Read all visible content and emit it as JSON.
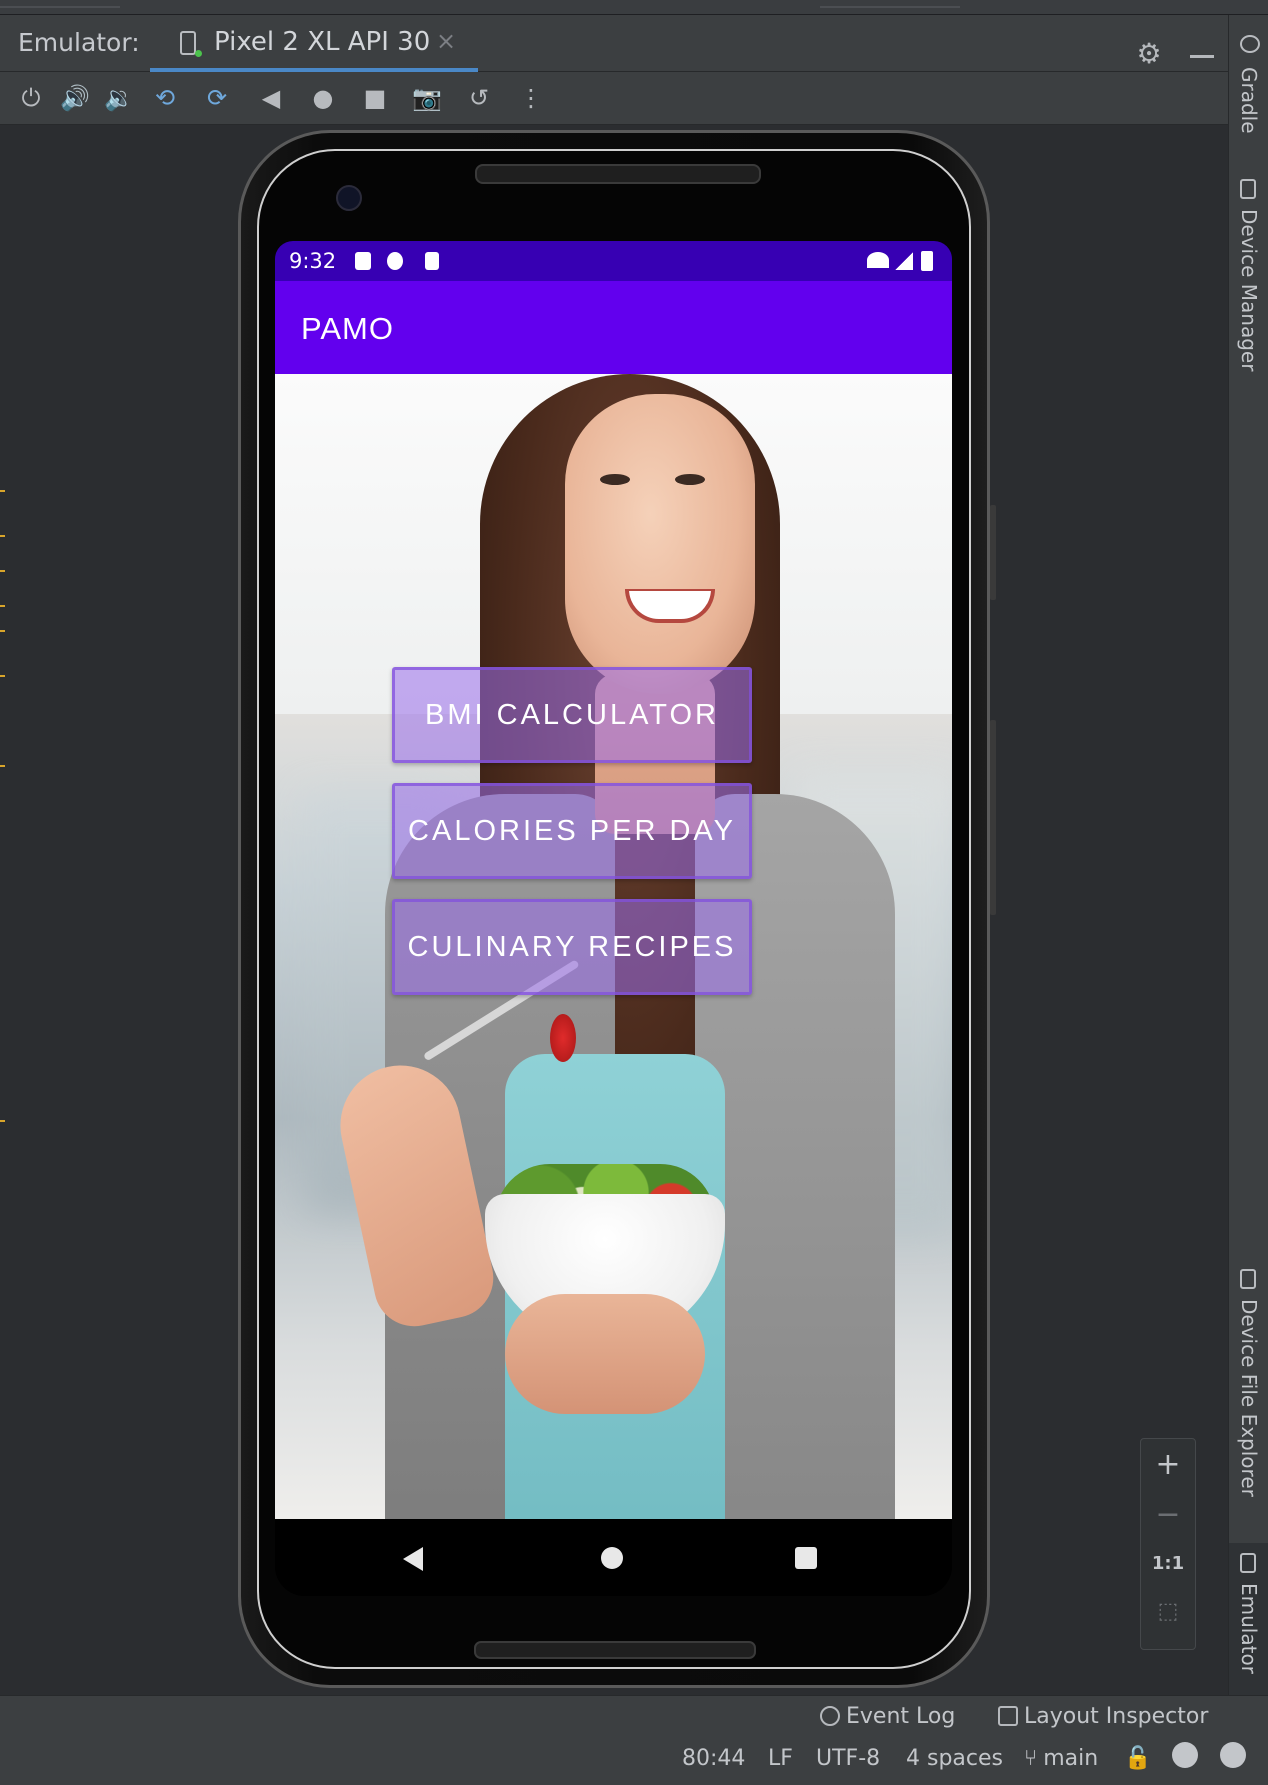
{
  "ide": {
    "panel_label": "Emulator:",
    "device_tab": "Pixel 2 XL API 30",
    "tab_close": "×",
    "side_tabs": {
      "gradle": "Gradle",
      "device_manager": "Device Manager",
      "device_file_explorer": "Device File Explorer",
      "emulator": "Emulator"
    },
    "zoom": {
      "plus": "+",
      "minus": "−",
      "actual": "1:1"
    },
    "status_bar": {
      "event_log": "Event Log",
      "layout_inspector": "Layout Inspector",
      "position": "80:44",
      "line_sep": "LF",
      "encoding": "UTF-8",
      "indent": "4 spaces",
      "branch": "main"
    }
  },
  "toolbar_icons": [
    "power-icon",
    "volume-up-icon",
    "volume-down-icon",
    "rotate-left-icon",
    "rotate-right-icon",
    "back-icon",
    "home-icon",
    "overview-icon",
    "camera-icon",
    "snapshot-icon",
    "more-icon"
  ],
  "device": {
    "time": "9:32",
    "app_title": "PAMO",
    "buttons": {
      "bmi": "BMI CALCULATOR",
      "calories": "CALORIES PER DAY",
      "recipes": "CULINARY RECIPES"
    }
  },
  "colors": {
    "status_bar": "#3700b3",
    "app_bar": "#6200ee",
    "button_fill": "#9b6eeb",
    "ide_accent": "#4a88c7"
  }
}
